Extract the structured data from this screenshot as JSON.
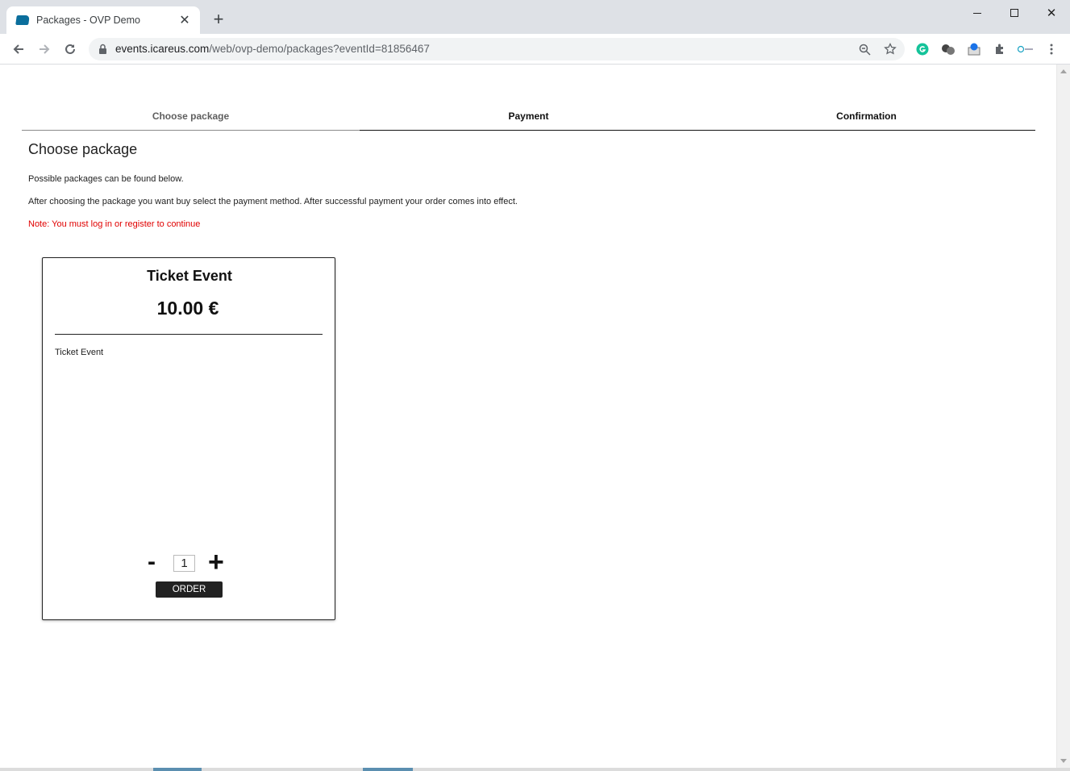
{
  "browser": {
    "tab_title": "Packages - OVP Demo",
    "new_tab_label": "+",
    "url_host": "events.icareus.com",
    "url_path": "/web/ovp-demo/packages?eventId=81856467"
  },
  "steps": [
    {
      "label": "Choose package"
    },
    {
      "label": "Payment"
    },
    {
      "label": "Confirmation"
    }
  ],
  "page": {
    "heading": "Choose package",
    "intro": "Possible packages can be found below.",
    "instructions": "After choosing the package you want buy select the payment method. After successful payment your order comes into effect.",
    "note": "Note: You must log in or register to continue"
  },
  "package": {
    "title": "Ticket Event",
    "price": "10.00 €",
    "description": "Ticket Event",
    "quantity": "1",
    "minus_label": "-",
    "plus_label": "+",
    "order_label": "ORDER"
  },
  "colors": {
    "accent_note": "#e00000",
    "button_bg": "#222222",
    "chrome_bg": "#dee1e6"
  }
}
